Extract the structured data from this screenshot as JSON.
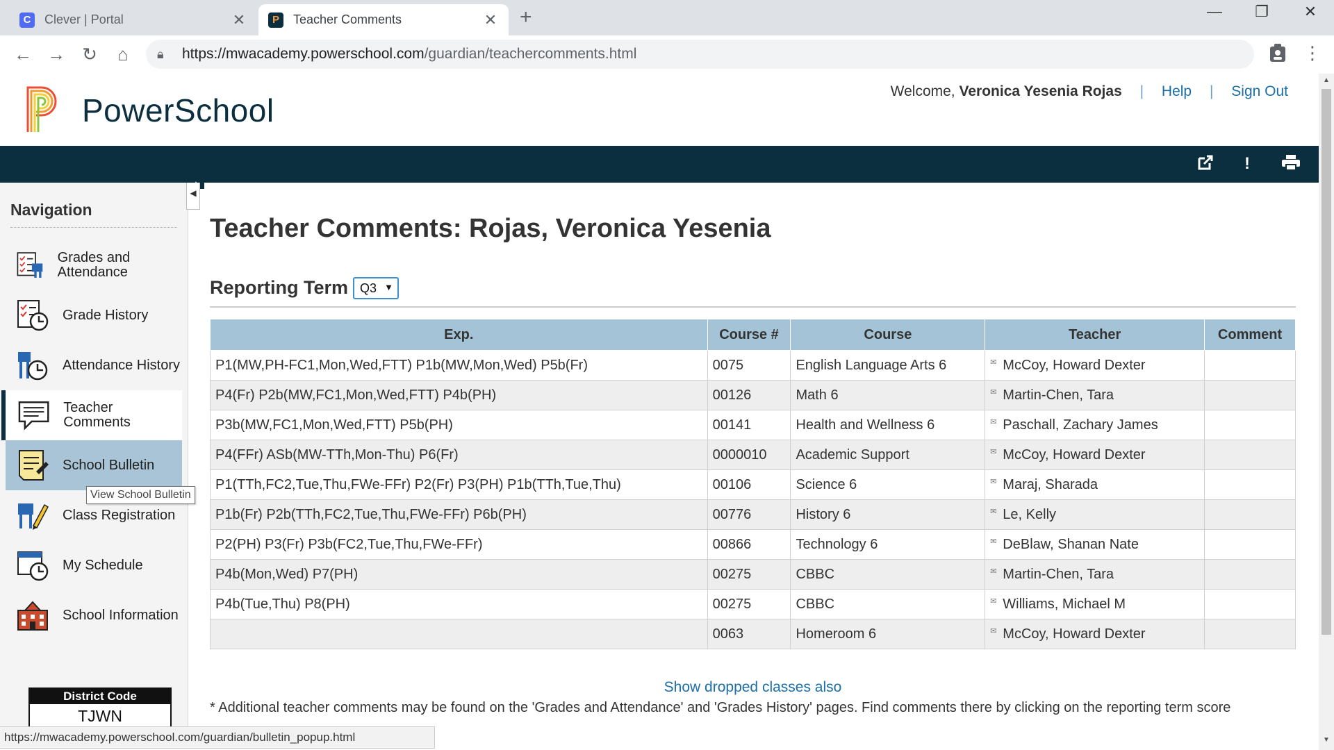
{
  "browser": {
    "tabs": [
      {
        "title": "Clever | Portal",
        "icon": "clever-icon",
        "active": false
      },
      {
        "title": "Teacher Comments",
        "icon": "powerschool-icon",
        "active": true
      }
    ],
    "url_host": "https://mwacademy.powerschool.com",
    "url_path": "/guardian/teachercomments.html",
    "status_url": "https://mwacademy.powerschool.com/guardian/bulletin_popup.html"
  },
  "header": {
    "brand": "PowerSchool",
    "welcome_prefix": "Welcome,",
    "user_name": "Veronica Yesenia Rojas",
    "help": "Help",
    "sign_out": "Sign Out"
  },
  "sidebar": {
    "title": "Navigation",
    "items": [
      {
        "label": "Grades and Attendance",
        "icon": "grades-attendance-icon"
      },
      {
        "label": "Grade History",
        "icon": "grade-history-icon"
      },
      {
        "label": "Attendance History",
        "icon": "attendance-history-icon"
      },
      {
        "label": "Teacher Comments",
        "icon": "teacher-comments-icon",
        "current": true
      },
      {
        "label": "School Bulletin",
        "icon": "school-bulletin-icon",
        "hover": true
      },
      {
        "label": "Class Registration",
        "icon": "class-registration-icon"
      },
      {
        "label": "My Schedule",
        "icon": "my-schedule-icon"
      },
      {
        "label": "School Information",
        "icon": "school-information-icon"
      }
    ],
    "tooltip": "View School Bulletin",
    "district_code_label": "District Code",
    "district_code": "TJWN"
  },
  "main": {
    "title": "Teacher Comments: Rojas, Veronica Yesenia",
    "reporting_term_label": "Reporting Term",
    "reporting_term_value": "Q3",
    "table": {
      "headers": [
        "Exp.",
        "Course #",
        "Course",
        "Teacher",
        "Comment"
      ],
      "rows": [
        {
          "exp": "P1(MW,PH-FC1,Mon,Wed,FTT) P1b(MW,Mon,Wed) P5b(Fr)",
          "course_num": "0075",
          "course": "English Language Arts 6",
          "teacher": "McCoy, Howard Dexter",
          "comment": ""
        },
        {
          "exp": "P4(Fr) P2b(MW,FC1,Mon,Wed,FTT) P4b(PH)",
          "course_num": "00126",
          "course": "Math 6",
          "teacher": "Martin-Chen, Tara",
          "comment": ""
        },
        {
          "exp": "P3b(MW,FC1,Mon,Wed,FTT) P5b(PH)",
          "course_num": "00141",
          "course": "Health and Wellness 6",
          "teacher": "Paschall, Zachary James",
          "comment": ""
        },
        {
          "exp": "P4(FFr) ASb(MW-TTh,Mon-Thu) P6(Fr)",
          "course_num": "0000010",
          "course": "Academic Support",
          "teacher": "McCoy, Howard Dexter",
          "comment": ""
        },
        {
          "exp": "P1(TTh,FC2,Tue,Thu,FWe-FFr) P2(Fr) P3(PH) P1b(TTh,Tue,Thu)",
          "course_num": "00106",
          "course": "Science 6",
          "teacher": "Maraj, Sharada",
          "comment": ""
        },
        {
          "exp": "P1b(Fr) P2b(TTh,FC2,Tue,Thu,FWe-FFr) P6b(PH)",
          "course_num": "00776",
          "course": "History 6",
          "teacher": "Le, Kelly",
          "comment": ""
        },
        {
          "exp": "P2(PH) P3(Fr) P3b(FC2,Tue,Thu,FWe-FFr)",
          "course_num": "00866",
          "course": "Technology 6",
          "teacher": "DeBlaw, Shanan Nate",
          "comment": ""
        },
        {
          "exp": "P4b(Mon,Wed) P7(PH)",
          "course_num": "00275",
          "course": "CBBC",
          "teacher": "Martin-Chen, Tara",
          "comment": ""
        },
        {
          "exp": "P4b(Tue,Thu) P8(PH)",
          "course_num": "00275",
          "course": "CBBC",
          "teacher": "Williams, Michael M",
          "comment": ""
        },
        {
          "exp": "",
          "course_num": "0063",
          "course": "Homeroom 6",
          "teacher": "McCoy, Howard Dexter",
          "comment": ""
        }
      ]
    },
    "show_dropped": "Show dropped classes also",
    "footnote": "* Additional teacher comments may be found on the 'Grades and Attendance' and 'Grades History' pages. Find comments there by clicking on the reporting term score"
  },
  "colors": {
    "header_bar": "#0b2f3f",
    "table_header": "#a5c3d6",
    "link": "#1b6fa8",
    "hover_nav": "#a9c4d6"
  }
}
